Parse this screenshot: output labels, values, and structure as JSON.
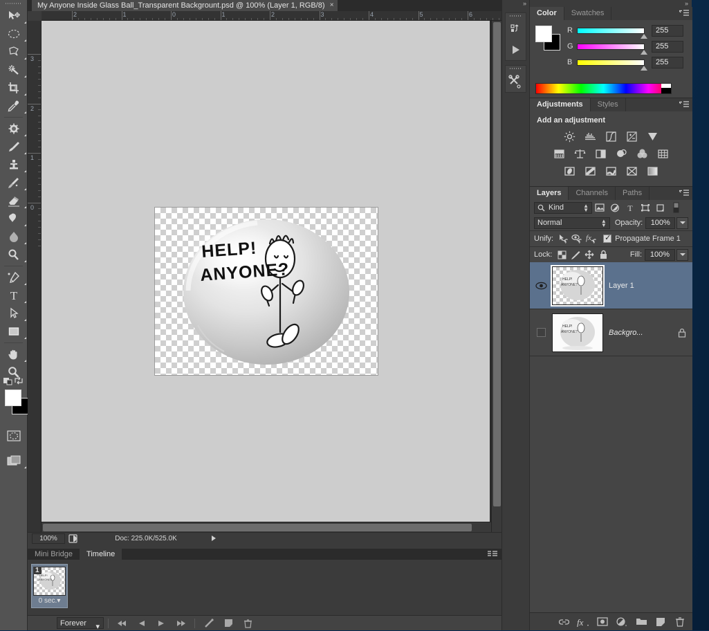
{
  "app": {
    "document_tab_title": "My Anyone Inside Glass Ball_Transparent Backgrount.psd @ 100% (Layer 1, RGB/8)",
    "close_tab": "×"
  },
  "rulers": {
    "horizontal_labels": [
      "2",
      "1",
      "0",
      "1",
      "2",
      "3",
      "4",
      "5",
      "6"
    ],
    "vertical_labels": [
      "3",
      "2",
      "1",
      "0"
    ]
  },
  "artwork": {
    "text_line1": "HELP!",
    "text_line2": "ANYONE?",
    "description": "glass-ball-stick-figure"
  },
  "statusbar": {
    "zoom": "100%",
    "doc_info": "Doc: 225.0K/525.0K"
  },
  "bottom_panel": {
    "tabs": [
      {
        "label": "Mini Bridge",
        "active": false
      },
      {
        "label": "Timeline",
        "active": true
      }
    ],
    "frame": {
      "number": "1",
      "delay": "0 sec."
    },
    "loop": "Forever"
  },
  "color_panel": {
    "tabs": [
      {
        "label": "Color",
        "active": true
      },
      {
        "label": "Swatches",
        "active": false
      }
    ],
    "channels": [
      {
        "label": "R",
        "value": "255"
      },
      {
        "label": "G",
        "value": "255"
      },
      {
        "label": "B",
        "value": "255"
      }
    ],
    "foreground": "#ffffff",
    "background": "#000000"
  },
  "adjustments_panel": {
    "tabs": [
      {
        "label": "Adjustments",
        "active": true
      },
      {
        "label": "Styles",
        "active": false
      }
    ],
    "title": "Add an adjustment",
    "row1": [
      "brightness-contrast-icon",
      "levels-icon",
      "curves-icon",
      "exposure-icon",
      "vibrance-icon"
    ],
    "row2": [
      "hue-saturation-icon",
      "color-balance-icon",
      "black-white-icon",
      "photo-filter-icon",
      "channel-mixer-icon",
      "color-lookup-icon"
    ],
    "row3": [
      "invert-icon",
      "posterize-icon",
      "threshold-icon",
      "selective-color-icon",
      "gradient-map-icon"
    ]
  },
  "layers_panel": {
    "tabs": [
      {
        "label": "Layers",
        "active": true
      },
      {
        "label": "Channels",
        "active": false
      },
      {
        "label": "Paths",
        "active": false
      }
    ],
    "filter_kind": "Kind",
    "blend_mode": "Normal",
    "opacity_label": "Opacity:",
    "opacity_value": "100%",
    "unify_label": "Unify:",
    "propagate_label": "Propagate Frame 1",
    "lock_label": "Lock:",
    "fill_label": "Fill:",
    "fill_value": "100%",
    "layers": [
      {
        "name": "Layer 1",
        "visible": true,
        "selected": true,
        "locked": false,
        "italic": false
      },
      {
        "name": "Backgro...",
        "visible": false,
        "selected": false,
        "locked": true,
        "italic": true
      }
    ]
  },
  "toolbar": {
    "tools": [
      "move-tool-icon",
      "marquee-tool-icon",
      "lasso-tool-icon",
      "magic-wand-tool-icon",
      "crop-tool-icon",
      "eyedropper-tool-icon",
      "spot-healing-tool-icon",
      "brush-tool-icon",
      "clone-stamp-tool-icon",
      "history-brush-tool-icon",
      "eraser-tool-icon",
      "gradient-tool-icon",
      "blur-tool-icon",
      "dodge-tool-icon",
      "pen-tool-icon",
      "type-tool-icon",
      "path-selection-tool-icon",
      "rectangle-tool-icon",
      "hand-tool-icon",
      "zoom-tool-icon"
    ],
    "foreground_color": "#ffffff",
    "background_color": "#000000"
  },
  "theme": {
    "panel_bg": "#454545",
    "chrome_bg": "#3b3b3b",
    "selected_layer": "#5b718d",
    "text": "#e8e8e8"
  }
}
